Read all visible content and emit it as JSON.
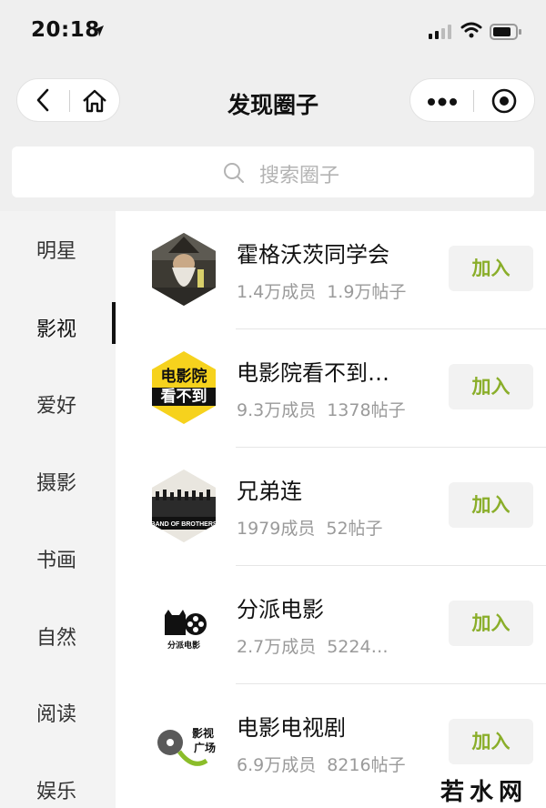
{
  "status_bar": {
    "time": "20:18"
  },
  "nav": {
    "title": "发现圈子"
  },
  "search": {
    "placeholder": "搜索圈子"
  },
  "sidebar": {
    "items": [
      {
        "label": "明星",
        "active": false
      },
      {
        "label": "影视",
        "active": true
      },
      {
        "label": "爱好",
        "active": false
      },
      {
        "label": "摄影",
        "active": false
      },
      {
        "label": "书画",
        "active": false
      },
      {
        "label": "自然",
        "active": false
      },
      {
        "label": "阅读",
        "active": false
      },
      {
        "label": "娱乐",
        "active": false
      }
    ]
  },
  "circles": [
    {
      "name": "霍格沃茨同学会",
      "members": "1.4万成员",
      "posts": "1.9万帖子",
      "join_label": "加入",
      "avatar_text": ""
    },
    {
      "name": "电影院看不到…",
      "members": "9.3万成员",
      "posts": "1378帖子",
      "join_label": "加入",
      "avatar_text": "电影院看不到"
    },
    {
      "name": "兄弟连",
      "members": "1979成员",
      "posts": "52帖子",
      "join_label": "加入",
      "avatar_text": "BAND OF BROTHERS"
    },
    {
      "name": "分派电影",
      "members": "2.7万成员",
      "posts": "5224…",
      "join_label": "加入",
      "avatar_text": "分派电影"
    },
    {
      "name": "电影电视剧",
      "members": "6.9万成员",
      "posts": "8216帖子",
      "join_label": "加入",
      "avatar_text": "影视广场"
    }
  ],
  "watermark": "若水网",
  "colors": {
    "join_text": "#8aae2a",
    "sidebar_bg": "#f3f3f3",
    "active_indicator": "#111111"
  }
}
